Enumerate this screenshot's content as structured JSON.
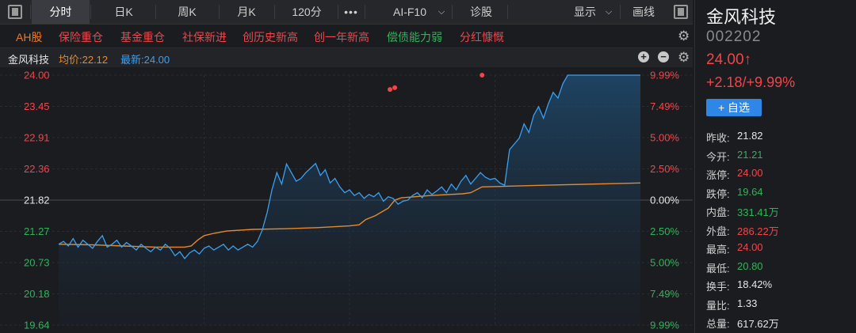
{
  "toolbar": {
    "tabs": [
      {
        "label": "分时",
        "active": true
      },
      {
        "label": "日K"
      },
      {
        "label": "周K"
      },
      {
        "label": "月K"
      },
      {
        "label": "120分"
      },
      {
        "label": "•••"
      },
      {
        "label": "AI-F10"
      },
      {
        "label": "诊股"
      },
      {
        "label": "显示"
      },
      {
        "label": "画线"
      }
    ]
  },
  "tags": [
    {
      "label": "AH股",
      "color": "#ee7a22"
    },
    {
      "label": "保险重仓",
      "color": "#f0454a"
    },
    {
      "label": "基金重仓",
      "color": "#f0454a"
    },
    {
      "label": "社保新进",
      "color": "#f0454a"
    },
    {
      "label": "创历史新高",
      "color": "#f0454a"
    },
    {
      "label": "创一年新高",
      "color": "#f0454a"
    },
    {
      "label": "偿债能力弱",
      "color": "#2fb35a"
    },
    {
      "label": "分红慷慨",
      "color": "#f0454a"
    }
  ],
  "chart_header": {
    "name": "金风科技",
    "avg_label": "均价:22.12",
    "last_label": "最新:24.00"
  },
  "stock": {
    "name": "金风科技",
    "code": "002202",
    "price": "24.00↑",
    "change": "+2.18/+9.99%",
    "add_button": "+ 自选"
  },
  "stats": [
    {
      "label": "昨收:",
      "value": "21.82",
      "color": "white"
    },
    {
      "label": "今开:",
      "value": "21.21",
      "color": "green"
    },
    {
      "label": "涨停:",
      "value": "24.00",
      "color": "red"
    },
    {
      "label": "跌停:",
      "value": "19.64",
      "color": "green"
    },
    {
      "label": "内盘:",
      "value": "331.41万",
      "color": "green"
    },
    {
      "label": "外盘:",
      "value": "286.22万",
      "color": "red"
    },
    {
      "label": "最高:",
      "value": "24.00",
      "color": "red"
    },
    {
      "label": "最低:",
      "value": "20.80",
      "color": "green"
    },
    {
      "label": "换手:",
      "value": "18.42%",
      "color": "white"
    },
    {
      "label": "量比:",
      "value": "1.33",
      "color": "white"
    },
    {
      "label": "总量:",
      "value": "617.62万",
      "color": "white"
    }
  ],
  "chart_data": {
    "type": "line",
    "prev_close": 21.82,
    "ylim": [
      19.64,
      24.0
    ],
    "y_ticks_left": [
      "24.00",
      "23.45",
      "22.91",
      "22.36",
      "21.82",
      "21.27",
      "20.73",
      "20.18",
      "19.64"
    ],
    "y_ticks_right": [
      "9.99%",
      "7.49%",
      "5.00%",
      "2.50%",
      "0.00%",
      "2.50%",
      "5.00%",
      "7.49%",
      "9.99%"
    ],
    "x_range": [
      0,
      240
    ],
    "series": [
      {
        "name": "最新",
        "color": "#3aa0f0",
        "points": [
          [
            0,
            21.05
          ],
          [
            2,
            21.1
          ],
          [
            4,
            21.02
          ],
          [
            6,
            21.15
          ],
          [
            8,
            21.0
          ],
          [
            10,
            21.12
          ],
          [
            12,
            21.05
          ],
          [
            14,
            20.98
          ],
          [
            16,
            21.1
          ],
          [
            18,
            21.2
          ],
          [
            20,
            21.0
          ],
          [
            22,
            21.05
          ],
          [
            24,
            21.12
          ],
          [
            26,
            21.0
          ],
          [
            28,
            21.08
          ],
          [
            30,
            21.02
          ],
          [
            32,
            20.95
          ],
          [
            34,
            21.05
          ],
          [
            36,
            20.98
          ],
          [
            38,
            20.92
          ],
          [
            40,
            21.0
          ],
          [
            42,
            20.95
          ],
          [
            44,
            21.05
          ],
          [
            46,
            20.98
          ],
          [
            48,
            20.85
          ],
          [
            50,
            20.92
          ],
          [
            52,
            20.8
          ],
          [
            54,
            20.9
          ],
          [
            56,
            20.95
          ],
          [
            58,
            20.88
          ],
          [
            60,
            20.98
          ],
          [
            62,
            21.02
          ],
          [
            64,
            20.95
          ],
          [
            66,
            21.0
          ],
          [
            68,
            21.05
          ],
          [
            70,
            20.95
          ],
          [
            72,
            21.02
          ],
          [
            74,
            20.95
          ],
          [
            76,
            21.0
          ],
          [
            78,
            21.05
          ],
          [
            80,
            21.0
          ],
          [
            82,
            21.1
          ],
          [
            84,
            21.3
          ],
          [
            86,
            21.6
          ],
          [
            88,
            22.0
          ],
          [
            90,
            22.3
          ],
          [
            92,
            22.1
          ],
          [
            94,
            22.45
          ],
          [
            96,
            22.3
          ],
          [
            98,
            22.15
          ],
          [
            100,
            22.2
          ],
          [
            102,
            22.3
          ],
          [
            104,
            22.38
          ],
          [
            106,
            22.46
          ],
          [
            108,
            22.25
          ],
          [
            110,
            22.35
          ],
          [
            112,
            22.12
          ],
          [
            114,
            22.2
          ],
          [
            116,
            22.05
          ],
          [
            118,
            21.95
          ],
          [
            120,
            22.0
          ],
          [
            122,
            21.9
          ],
          [
            124,
            21.95
          ],
          [
            126,
            21.85
          ],
          [
            128,
            21.92
          ],
          [
            130,
            21.88
          ],
          [
            132,
            21.95
          ],
          [
            134,
            21.8
          ],
          [
            136,
            21.88
          ],
          [
            138,
            21.85
          ],
          [
            140,
            21.75
          ],
          [
            142,
            21.8
          ],
          [
            144,
            21.82
          ],
          [
            146,
            21.9
          ],
          [
            148,
            21.95
          ],
          [
            150,
            21.86
          ],
          [
            152,
            22.0
          ],
          [
            154,
            21.92
          ],
          [
            156,
            21.98
          ],
          [
            158,
            22.05
          ],
          [
            160,
            21.95
          ],
          [
            162,
            22.1
          ],
          [
            164,
            22.0
          ],
          [
            166,
            22.15
          ],
          [
            168,
            22.25
          ],
          [
            170,
            22.1
          ],
          [
            172,
            22.2
          ],
          [
            174,
            22.3
          ],
          [
            176,
            22.22
          ],
          [
            178,
            22.18
          ],
          [
            180,
            22.2
          ],
          [
            182,
            22.12
          ],
          [
            184,
            22.08
          ],
          [
            186,
            22.7
          ],
          [
            188,
            22.8
          ],
          [
            190,
            22.9
          ],
          [
            192,
            23.15
          ],
          [
            194,
            23.0
          ],
          [
            196,
            23.3
          ],
          [
            198,
            23.45
          ],
          [
            200,
            23.25
          ],
          [
            202,
            23.5
          ],
          [
            204,
            23.7
          ],
          [
            206,
            23.6
          ],
          [
            208,
            23.85
          ],
          [
            210,
            24.0
          ],
          [
            240,
            24.0
          ]
        ]
      },
      {
        "name": "均价",
        "color": "#e58a2c",
        "points": [
          [
            0,
            21.05
          ],
          [
            20,
            21.04
          ],
          [
            40,
            21.02
          ],
          [
            60,
            21.0
          ],
          [
            78,
            21.0
          ],
          [
            82,
            21.02
          ],
          [
            86,
            21.12
          ],
          [
            90,
            21.2
          ],
          [
            96,
            21.24
          ],
          [
            104,
            21.28
          ],
          [
            120,
            21.31
          ],
          [
            140,
            21.32
          ],
          [
            160,
            21.34
          ],
          [
            180,
            21.37
          ],
          [
            186,
            21.39
          ],
          [
            190,
            21.48
          ],
          [
            196,
            21.55
          ],
          [
            204,
            21.68
          ],
          [
            208,
            21.82
          ],
          [
            212,
            21.86
          ],
          [
            230,
            21.9
          ],
          [
            250,
            21.93
          ],
          [
            255,
            21.95
          ],
          [
            262,
            22.05
          ],
          [
            300,
            22.08
          ],
          [
            360,
            22.12
          ]
        ]
      }
    ],
    "limit_markers": [
      [
        205,
        23.75
      ],
      [
        208,
        23.78
      ],
      [
        262,
        24.0
      ]
    ]
  }
}
